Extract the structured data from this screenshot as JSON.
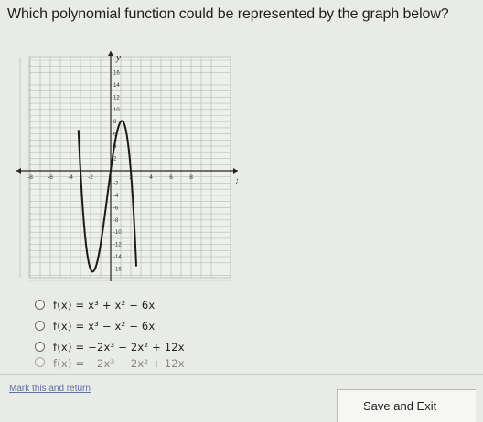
{
  "question": "Which polynomial function could be represented by the graph below?",
  "graph": {
    "axis_label_x": "x",
    "axis_label_y": "y",
    "x_ticks": [
      "-8",
      "-6",
      "-4",
      "-2",
      "2",
      "4",
      "6",
      "8"
    ],
    "y_ticks": [
      "16",
      "14",
      "12",
      "10",
      "8",
      "6",
      "4",
      "2",
      "-2",
      "-4",
      "-6",
      "-8",
      "-10",
      "-12",
      "-14",
      "-16"
    ]
  },
  "options": [
    {
      "label": "f(x) = x³ + x² − 6x"
    },
    {
      "label": "f(x) = x³ − x² − 6x"
    },
    {
      "label": "f(x) = −2x³ − 2x² + 12x"
    },
    {
      "label": "f(x) = −2x³ − 2x² + 12x"
    }
  ],
  "footer": {
    "mark_label": "Mark this and return",
    "save_label": "Save and Exit"
  },
  "colors": {
    "background": "#e9ebe7",
    "curve": "#1a1a1a",
    "grid": "#b9bcb6"
  }
}
